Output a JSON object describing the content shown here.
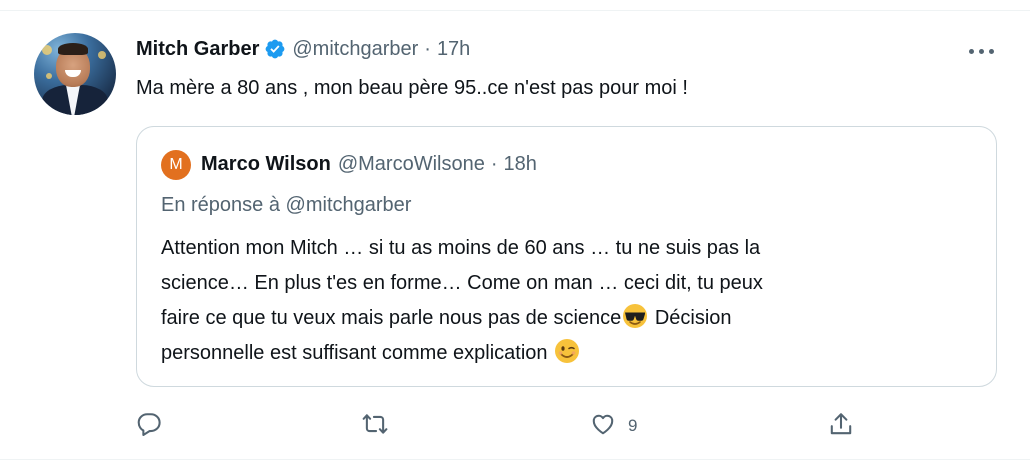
{
  "tweet": {
    "author_name": "Mitch Garber",
    "handle": "@mitchgarber",
    "separator": "·",
    "time": "17h",
    "text": "Ma mère a 80 ans , mon beau père 95..ce n'est pas pour moi !"
  },
  "quoted": {
    "avatar_letter": "M",
    "avatar_color": "#e2701f",
    "author_name": "Marco Wilson",
    "handle": "@MarcoWilsone",
    "separator": "·",
    "time": "18h",
    "reply_to": "En réponse à @mitchgarber",
    "line1": "Attention mon Mitch … si tu as moins de 60 ans … tu ne suis pas la",
    "line2": "science… En plus t'es en forme… Come on  man … ceci dit, tu peux",
    "line3_before": "faire ce que tu veux mais parle nous pas de science",
    "line3_emoji": "smiling-face-with-sunglasses",
    "line3_after": " Décision",
    "line4": "personnelle est suffisant comme explication ",
    "line4_emoji": "winking-face"
  },
  "actions": {
    "like_count": "9",
    "icons": [
      "reply-icon",
      "retweet-icon",
      "like-icon",
      "share-icon"
    ]
  },
  "colors": {
    "text": "#0f1419",
    "secondary": "#536471",
    "verified": "#1d9bf0",
    "border": "#cfd9de"
  }
}
